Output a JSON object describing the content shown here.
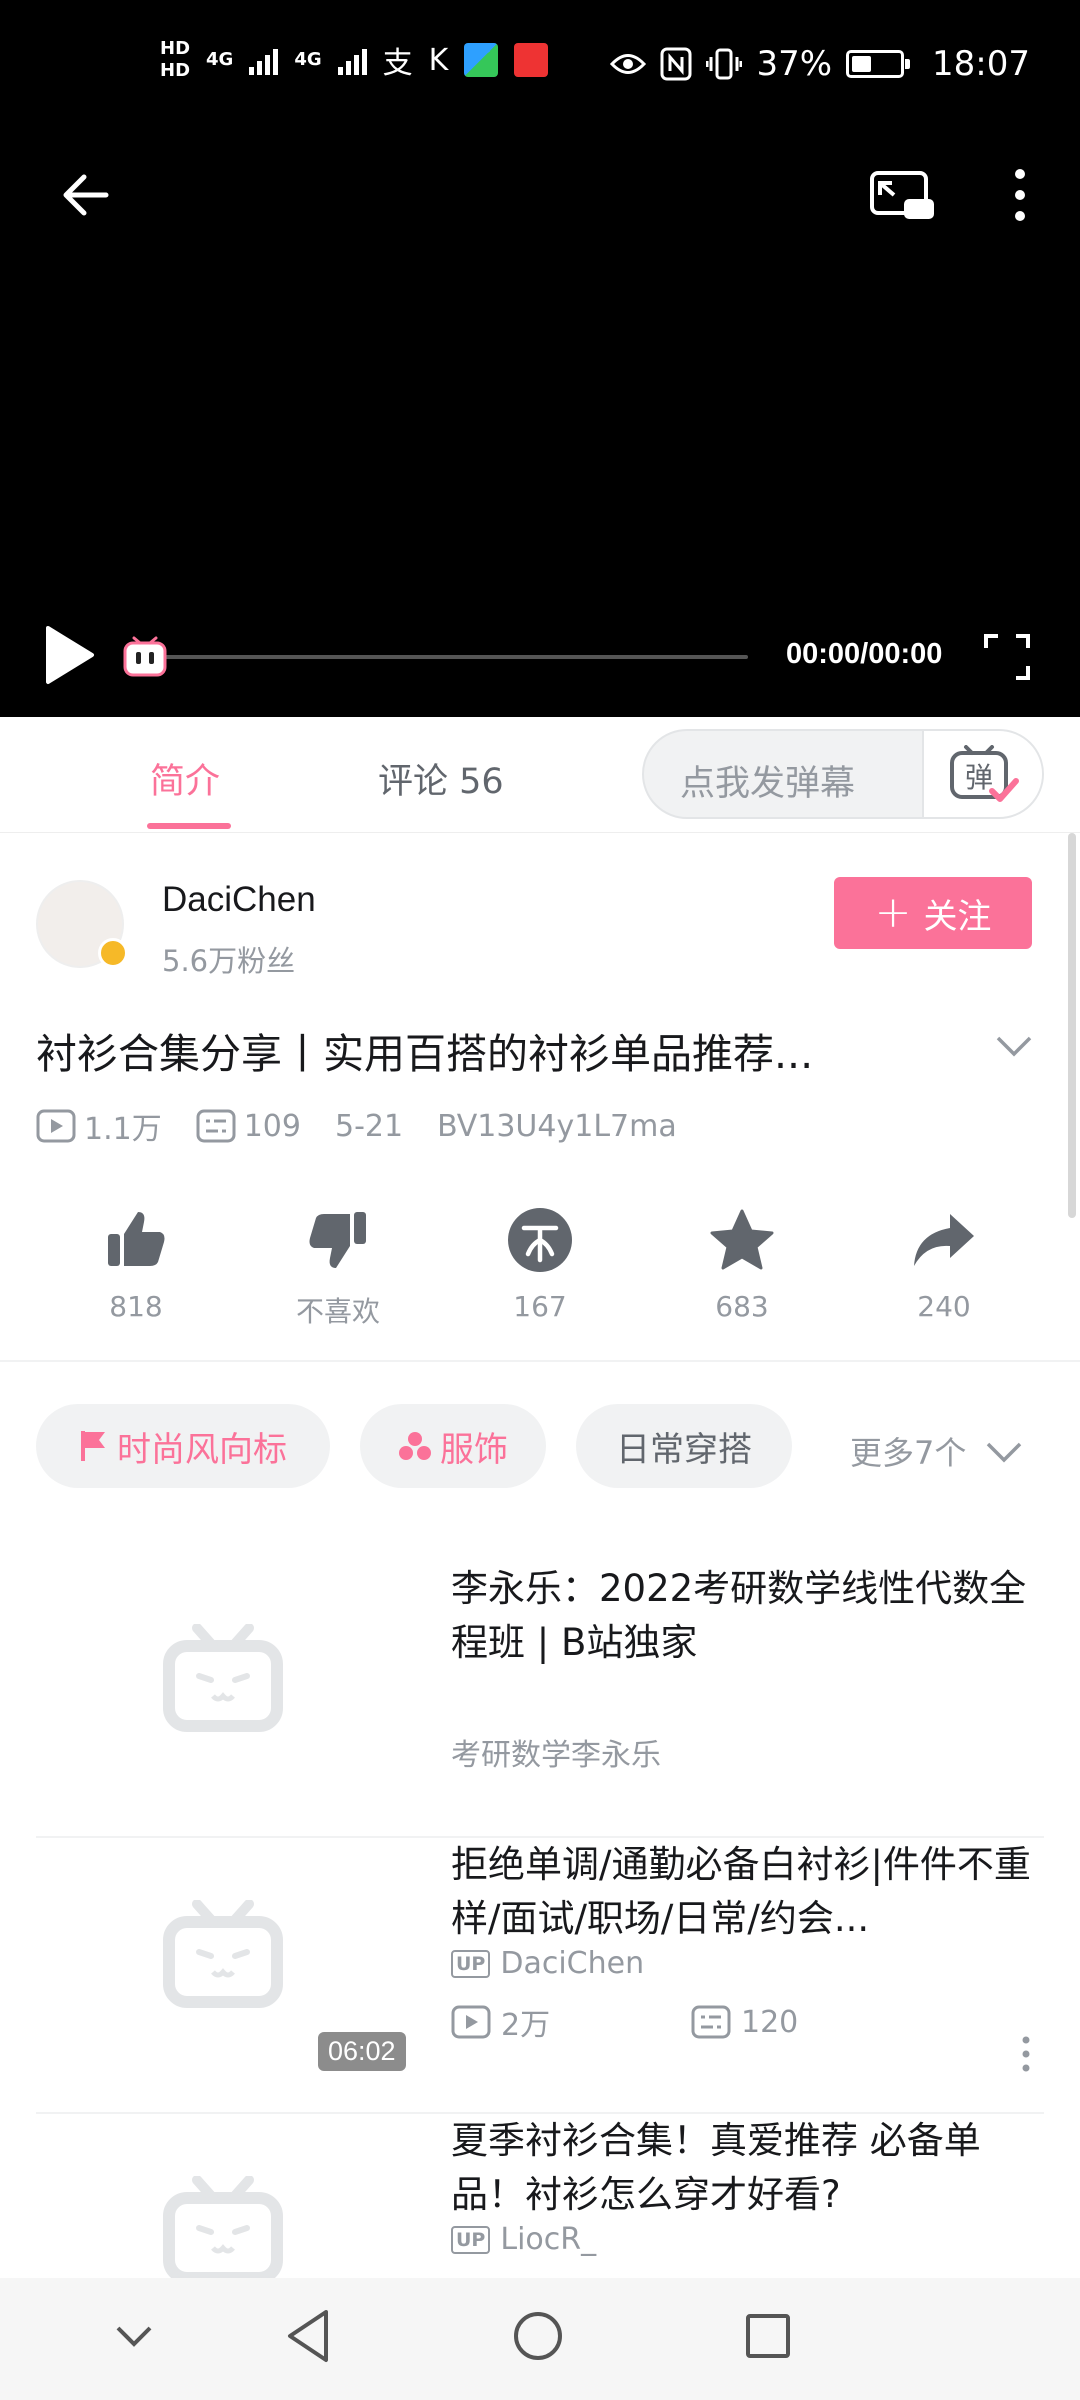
{
  "status_bar": {
    "hd1": "HD",
    "hd2": "HD",
    "net1": "4G",
    "net2": "4G",
    "battery_percent": "37%",
    "battery_level": 0.37,
    "time": "18:07"
  },
  "player": {
    "timecode": "00:00/00:00",
    "progress": 0.0
  },
  "tabs": {
    "intro": "简介",
    "comments": "评论 56",
    "danmaku_placeholder": "点我发弹幕"
  },
  "uploader": {
    "name": "DaciChen",
    "fans": "5.6万粉丝",
    "follow_label": "关注"
  },
  "video": {
    "title": "衬衫合集分享丨实用百搭的衬衫单品推荐...",
    "views": "1.1万",
    "danmaku_count": "109",
    "date": "5-21",
    "bvid": "BV13U4y1L7ma"
  },
  "actions": {
    "like": "818",
    "dislike": "不喜欢",
    "coin": "167",
    "favorite": "683",
    "share": "240"
  },
  "tags": {
    "items": [
      "时尚风向标",
      "服饰",
      "日常穿搭"
    ],
    "more": "更多7个"
  },
  "recommendations": [
    {
      "title": "李永乐：2022考研数学线性代数全程班 | B站独家",
      "author": "考研数学李永乐"
    },
    {
      "title": "拒绝单调/通勤必备白衬衫|件件不重样/面试/职场/日常/约会...",
      "up_badge": "UP",
      "author": "DaciChen",
      "views": "2万",
      "danmaku": "120",
      "duration": "06:02"
    },
    {
      "title": "夏季衬衫合集！真爱推荐 必备单品！衬衫怎么穿才好看?",
      "up_badge": "UP",
      "author": "LiocR_"
    }
  ],
  "colors": {
    "brand_pink": "#fb7299",
    "text_gray": "#9499a0",
    "tag_bg": "#f1f2f3"
  }
}
